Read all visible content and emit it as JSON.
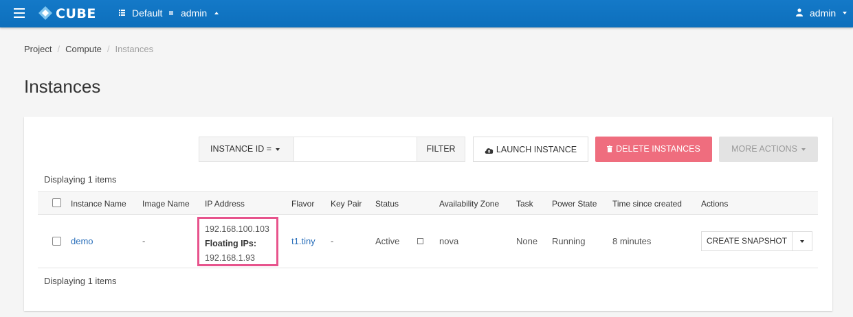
{
  "header": {
    "app_name": "CUBE",
    "project": "Default",
    "user_scope": "admin",
    "account": "admin"
  },
  "breadcrumb": {
    "items": [
      "Project",
      "Compute"
    ],
    "current": "Instances"
  },
  "page": {
    "title": "Instances"
  },
  "toolbar": {
    "filter_field": "INSTANCE ID =",
    "filter_value": "",
    "filter_button": "FILTER",
    "launch_button": "LAUNCH INSTANCE",
    "delete_button": "DELETE INSTANCES",
    "more_button": "MORE ACTIONS"
  },
  "table": {
    "count_label": "Displaying 1 items",
    "columns": [
      "Instance Name",
      "Image Name",
      "IP Address",
      "Flavor",
      "Key Pair",
      "Status",
      "Availability Zone",
      "Task",
      "Power State",
      "Time since created",
      "Actions"
    ],
    "rows": [
      {
        "name": "demo",
        "image": "-",
        "ip": "192.168.100.103",
        "floating_label": "Floating IPs:",
        "floating_ip": "192.168.1.93",
        "flavor": "t1.tiny",
        "key_pair": "-",
        "status": "Active",
        "zone": "nova",
        "task": "None",
        "power": "Running",
        "age": "8 minutes",
        "action": "CREATE SNAPSHOT"
      }
    ]
  },
  "colors": {
    "header": "#1479c8",
    "danger": "#ef6d7e",
    "highlight": "#e7538c",
    "link": "#2a6fba"
  }
}
